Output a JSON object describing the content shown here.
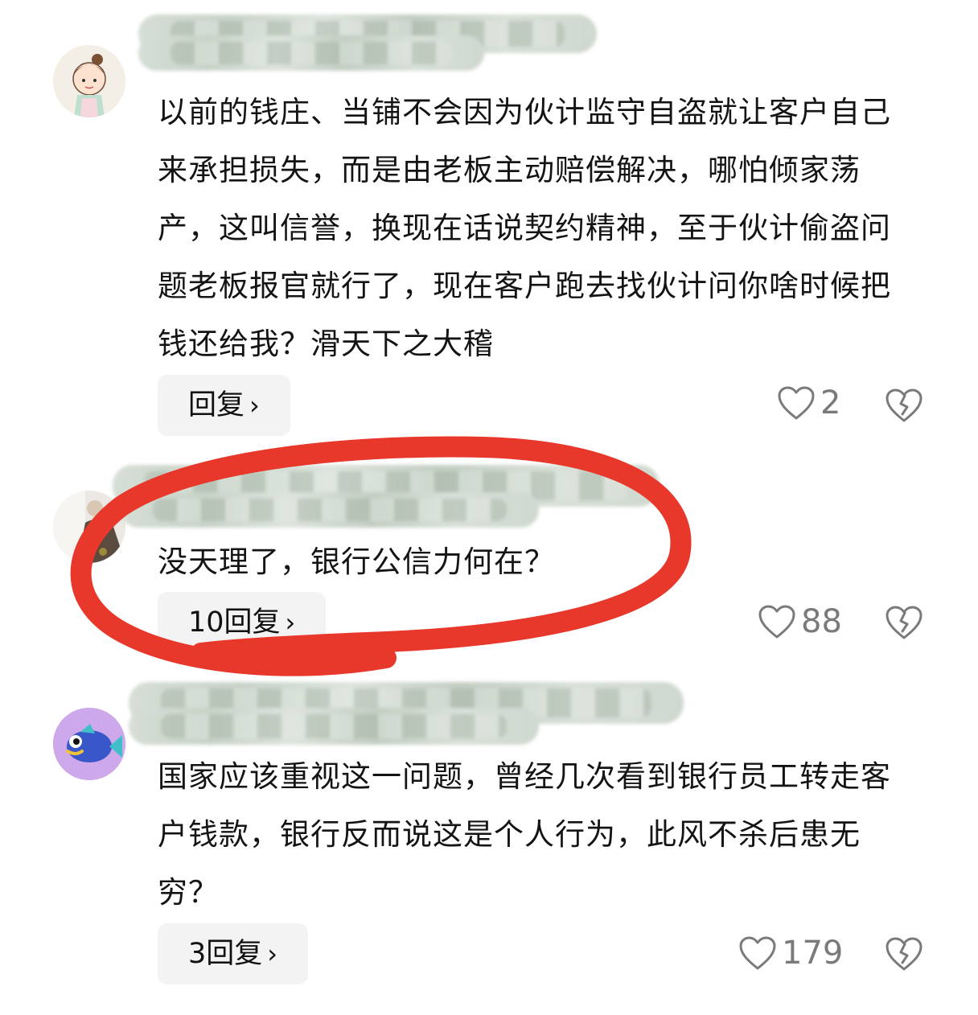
{
  "comments": [
    {
      "text": "以前的钱庄、当铺不会因为伙计监守自盗就让客户自己来承担损失，而是由老板主动赔偿解决，哪怕倾家荡产，这叫信誉，换现在话说契约精神，至于伙计偷盗问题老板报官就行了，现在客户跑去找伙计问你啥时候把钱还给我？滑天下之大稽",
      "reply_label": "回复",
      "likes": "2"
    },
    {
      "text": "没天理了，银行公信力何在？",
      "reply_label": "10回复",
      "likes": "88"
    },
    {
      "text": "国家应该重视这一问题，曾经几次看到银行员工转走客户钱款，银行反而说这是个人行为，此风不杀后患无穷？",
      "reply_label": "3回复",
      "likes": "179"
    }
  ],
  "colors": {
    "annotation_red": "#e8382b",
    "icon_gray": "#7a7a7a",
    "reply_bg": "#f3f3f3"
  },
  "icons": {
    "like": "heart-outline-icon",
    "dislike": "broken-heart-icon",
    "reply_arrow": "chevron-right-icon"
  }
}
